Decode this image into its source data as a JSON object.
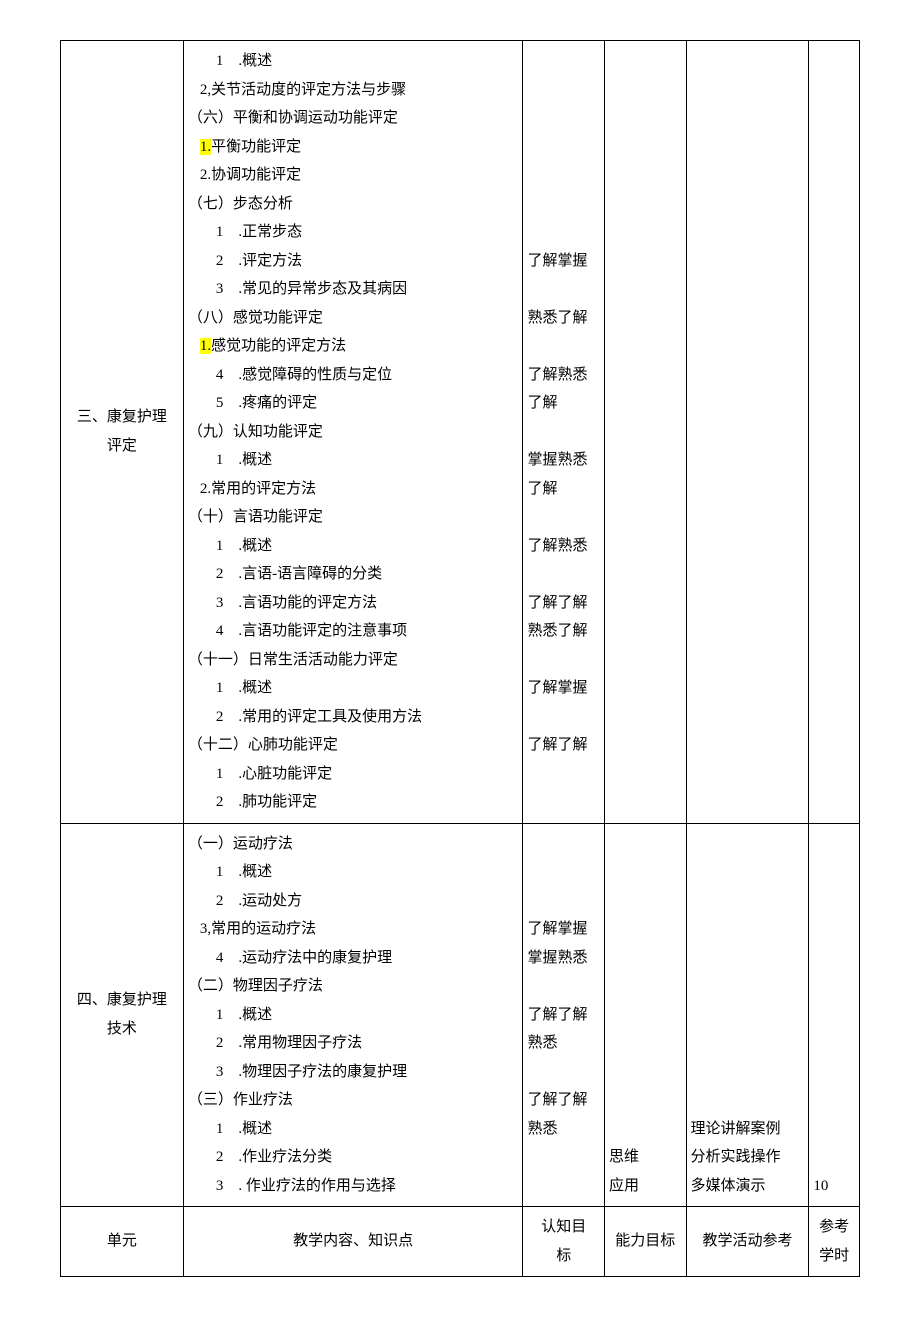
{
  "rows": [
    {
      "unit": "三、康复护理\n评定",
      "content": [
        {
          "cls": "in2",
          "txt": "1　.概述"
        },
        {
          "cls": "in1",
          "txt": "2,关节活动度的评定方法与步骤"
        },
        {
          "cls": "",
          "txt": "（六）平衡和协调运动功能评定"
        },
        {
          "cls": "in1",
          "hl": "1.",
          "txt": "平衡功能评定"
        },
        {
          "cls": "in1",
          "txt": "2.协调功能评定"
        },
        {
          "cls": "",
          "txt": "（七）步态分析"
        },
        {
          "cls": "in2",
          "txt": "1　.正常步态"
        },
        {
          "cls": "in2",
          "txt": "2　.评定方法"
        },
        {
          "cls": "in2",
          "txt": "3　.常见的异常步态及其病因"
        },
        {
          "cls": "",
          "txt": "（八）感觉功能评定"
        },
        {
          "cls": "in1",
          "hl": "1.",
          "txt": "感觉功能的评定方法"
        },
        {
          "cls": "in2",
          "txt": "4　.感觉障碍的性质与定位"
        },
        {
          "cls": "in2",
          "txt": "5　.疼痛的评定"
        },
        {
          "cls": "",
          "txt": "（九）认知功能评定"
        },
        {
          "cls": "in2",
          "txt": "1　.概述"
        },
        {
          "cls": "in1",
          "txt": "2.常用的评定方法"
        },
        {
          "cls": "",
          "txt": "（十）言语功能评定"
        },
        {
          "cls": "in2",
          "txt": "1　.概述"
        },
        {
          "cls": "in2",
          "txt": "2　.言语-语言障碍的分类"
        },
        {
          "cls": "in2",
          "txt": "3　.言语功能的评定方法"
        },
        {
          "cls": "in2",
          "txt": "4　.言语功能评定的注意事项"
        },
        {
          "cls": "",
          "txt": "（十一）日常生活活动能力评定"
        },
        {
          "cls": "in2",
          "txt": "1　.概述"
        },
        {
          "cls": "in2",
          "txt": "2　.常用的评定工具及使用方法"
        },
        {
          "cls": "",
          "txt": "（十二）心肺功能评定"
        },
        {
          "cls": "in2",
          "txt": "1　.心脏功能评定"
        },
        {
          "cls": "in2",
          "txt": "2　.肺功能评定"
        }
      ],
      "cognition": "\n\n\n\n\n\n\n了解掌握\n\n熟悉了解\n\n了解熟悉\n了解\n\n掌握熟悉\n了解\n\n了解熟悉\n\n了解了解\n熟悉了解\n\n了解掌握\n\n了解了解",
      "ability": "",
      "activity": "",
      "hours": ""
    },
    {
      "unit": "四、康复护理\n技术",
      "content": [
        {
          "cls": "",
          "txt": "（一）运动疗法"
        },
        {
          "cls": "in2",
          "txt": "1　.概述"
        },
        {
          "cls": "in2",
          "txt": "2　.运动处方"
        },
        {
          "cls": "in1",
          "txt": "3,常用的运动疗法"
        },
        {
          "cls": "in2",
          "txt": "4　.运动疗法中的康复护理"
        },
        {
          "cls": "",
          "txt": "（二）物理因子疗法"
        },
        {
          "cls": "in2",
          "txt": "1　.概述"
        },
        {
          "cls": "in2",
          "txt": "2　.常用物理因子疗法"
        },
        {
          "cls": "in2",
          "txt": "3　.物理因子疗法的康复护理"
        },
        {
          "cls": "",
          "txt": "（三）作业疗法"
        },
        {
          "cls": "in2",
          "txt": "1　.概述"
        },
        {
          "cls": "in2",
          "txt": "2　.作业疗法分类"
        },
        {
          "cls": "in2",
          "txt": "3　. 作业疗法的作用与选择"
        }
      ],
      "cognition": "\n\n\n了解掌握\n掌握熟悉\n\n了解了解\n熟悉\n\n了解了解\n熟悉",
      "ability": "思维\n应用",
      "activity": "理论讲解案例\n分析实践操作\n多媒体演示",
      "hours": "10"
    }
  ],
  "header": {
    "unit": "单元",
    "content": "教学内容、知识点",
    "cognition": "认知目\n标",
    "ability": "能力目标",
    "activity": "教学活动参考",
    "hours": "参考\n学时"
  }
}
